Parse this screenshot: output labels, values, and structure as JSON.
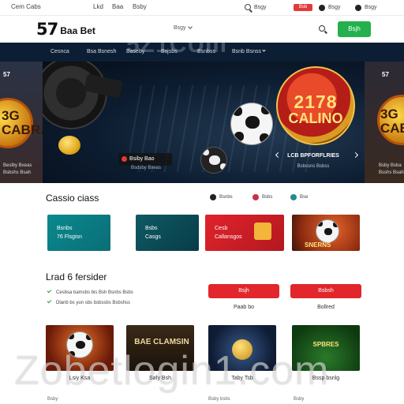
{
  "topbar": {
    "brand": "Cem Cabs",
    "links": [
      "Lkd",
      "Baa",
      "Bsby"
    ],
    "search_text": "Bsgy",
    "badge": "Bsb",
    "pill_1": "Bsgy",
    "pill_2": "Bsgy"
  },
  "header": {
    "logo_number": "57",
    "logo_name": "Baa Bet",
    "select_label": "Bsgy",
    "login_label": "Bsjh"
  },
  "nav": {
    "watermark": "5Z1CUIII",
    "items": [
      "Cesnca",
      "Bsa Bsnesh",
      "Baseby",
      "Bsjsbs",
      "Bsnbss",
      "Bsnb Bsnss"
    ]
  },
  "hero": {
    "left": {
      "top": "57",
      "big": "3G CABRA",
      "caption": "Beslby Bxeas\nBsbshs Bsah"
    },
    "right": {
      "top": "57",
      "big": "3G CABR",
      "caption": "Bsby Bsba\nBsshs Bsah"
    },
    "cta_label": "Bsiby Bao",
    "cta_sub": "Bsdsby Bxeas",
    "emblem_number": "2178",
    "emblem_word": "CALINO",
    "emblem_caption": "LCB BPFORFLRIES",
    "emblem_sub": "Bsbssns Bsbss"
  },
  "casino": {
    "title": "Cassio ciass",
    "filters": [
      "Bsnbs",
      "Bsbs",
      "Bse"
    ],
    "cards": [
      {
        "text": "Bsnbs\n76 Flsgisn"
      },
      {
        "text": "Bsbs\nCasgs"
      },
      {
        "text": "Cesb\nCallansgos"
      },
      {
        "text": "SNERNS"
      }
    ]
  },
  "latest": {
    "title": "Lrad 6 fersider",
    "items": [
      "Cesbsa bamsbs bis Bsh Bsnbs Bsbs",
      "Dlanb bs yun sbs bsbssbs Bsbshss"
    ],
    "buttons": [
      "Bsjh",
      "Bsbsh"
    ],
    "button_captions": [
      "Paab bo",
      "Bollred"
    ]
  },
  "tiles": [
    {
      "caption": "Lsiy Ksa"
    },
    {
      "caption": "Safy Bsh",
      "text": "BAE CLAMSIN"
    },
    {
      "caption": "Taby Tsb"
    },
    {
      "caption": "Bssp bsnlg",
      "text": "SPBRES"
    }
  ],
  "watermark": "Zobetlogin1.com",
  "footer": [
    "Bsby",
    "Bsby bsbs",
    "Bsby"
  ]
}
